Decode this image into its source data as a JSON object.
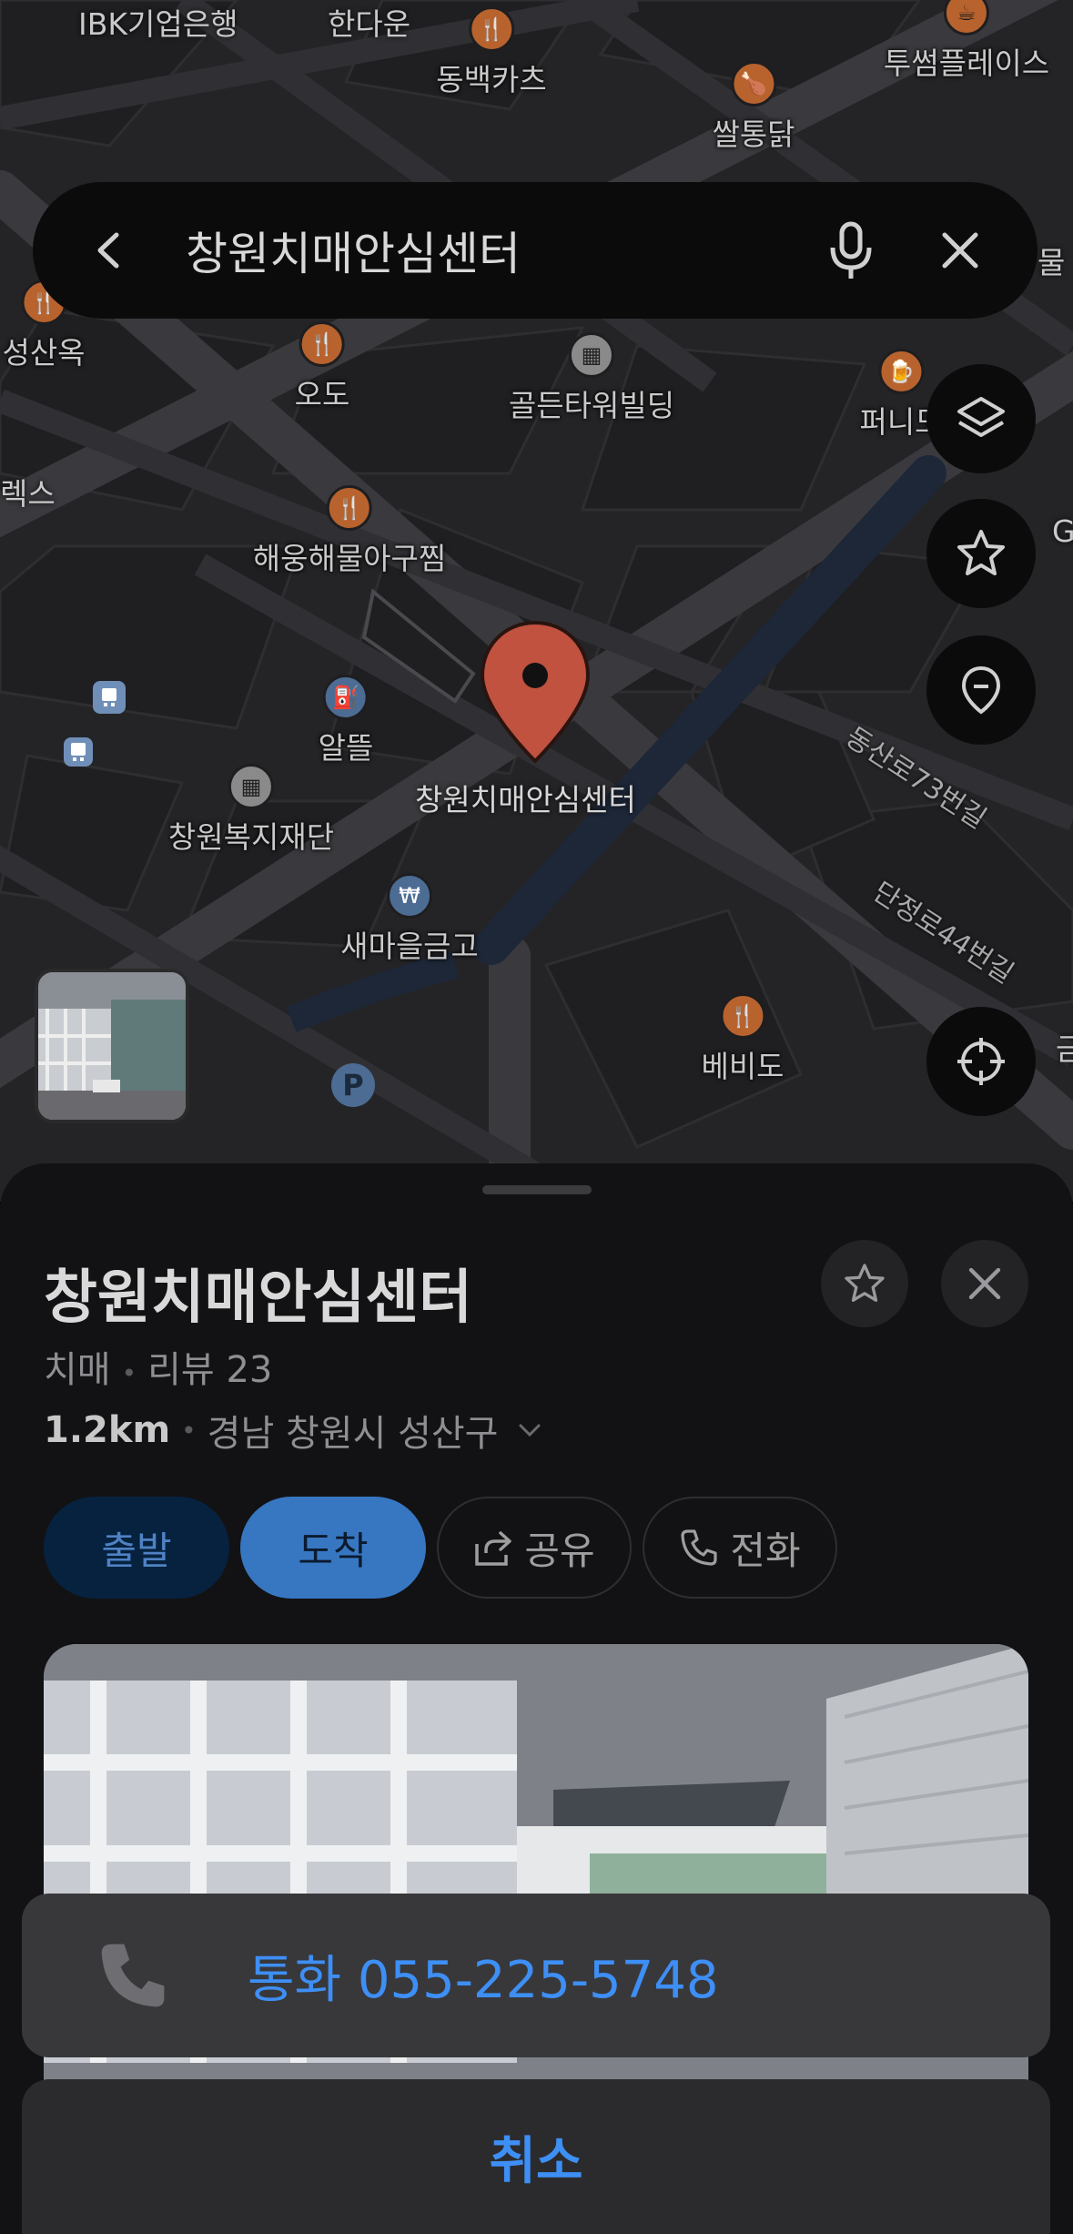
{
  "search": {
    "query": "창원치매안심센터",
    "back_icon": "chevron-left-icon",
    "mic_icon": "microphone-icon",
    "clear_icon": "close-icon"
  },
  "map": {
    "pois": [
      {
        "label": "IBK기업은행",
        "type": "bank"
      },
      {
        "label": "한다운",
        "type": "text"
      },
      {
        "label": "동백카츠",
        "type": "food"
      },
      {
        "label": "쌀통닭",
        "type": "food"
      },
      {
        "label": "투썸플레이스",
        "type": "food"
      },
      {
        "label": "성산옥",
        "type": "food"
      },
      {
        "label": "오도",
        "type": "food"
      },
      {
        "label": "골든타워빌딩",
        "type": "bldg"
      },
      {
        "label": "퍼니도",
        "type": "food"
      },
      {
        "label": "렉스",
        "type": "text"
      },
      {
        "label": "해웅해물아구찜",
        "type": "food"
      },
      {
        "label": "알뜰",
        "type": "gas"
      },
      {
        "label": "창원치매안심센터",
        "type": "pin"
      },
      {
        "label": "창원복지재단",
        "type": "bldg"
      },
      {
        "label": "새마을금고",
        "type": "bank"
      },
      {
        "label": "베비도",
        "type": "food"
      },
      {
        "label": "물",
        "type": "text"
      },
      {
        "label": "G",
        "type": "text"
      },
      {
        "label": "금",
        "type": "text"
      }
    ],
    "roads": [
      "동산로73번길",
      "단정로44번길"
    ],
    "controls": {
      "layers_icon": "layers-icon",
      "favorites_icon": "star-icon",
      "saved_place_icon": "location-pin-icon",
      "my_location_icon": "crosshair-icon"
    }
  },
  "place": {
    "name": "창원치매안심센터",
    "category": "치매",
    "reviews": "리뷰 23",
    "distance": "1.2km",
    "address": "경남 창원시 성산구",
    "actions": {
      "depart": "출발",
      "arrive": "도착",
      "share": "공유",
      "call": "전화"
    }
  },
  "action_sheet": {
    "call_label": "통화 055-225-5748",
    "cancel_label": "취소"
  },
  "colors": {
    "accent_blue": "#3e8ff5",
    "pin_red": "#c0523f",
    "sheet_bg": "#121214"
  }
}
